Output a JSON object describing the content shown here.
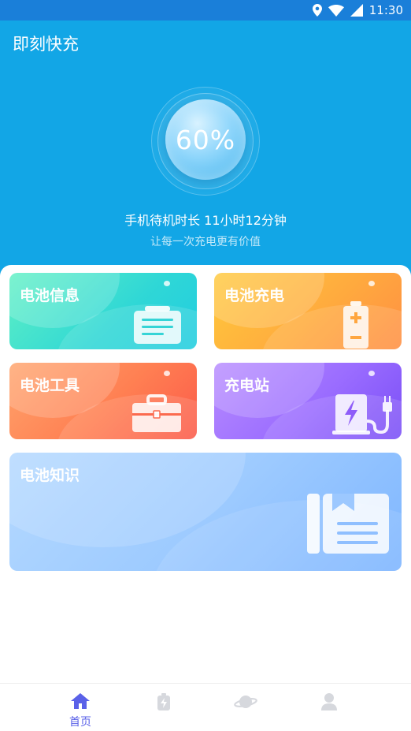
{
  "status_bar": {
    "time": "11:30"
  },
  "app": {
    "title": "即刻快充"
  },
  "battery": {
    "percent": "60%",
    "standby_text": "手机待机时长 11小时12分钟",
    "slogan": "让每一次充电更有价值"
  },
  "cards": [
    {
      "label": "电池信息",
      "icon": "battery-info-icon"
    },
    {
      "label": "电池充电",
      "icon": "battery-charge-icon"
    },
    {
      "label": "电池工具",
      "icon": "toolbox-icon"
    },
    {
      "label": "充电站",
      "icon": "charging-station-icon"
    },
    {
      "label": "电池知识",
      "icon": "book-icon"
    }
  ],
  "tabbar": {
    "tabs": [
      {
        "label": "首页",
        "icon": "home-icon",
        "active": true
      },
      {
        "label": "",
        "icon": "battery-icon",
        "active": false
      },
      {
        "label": "",
        "icon": "planet-icon",
        "active": false
      },
      {
        "label": "",
        "icon": "user-icon",
        "active": false
      }
    ]
  },
  "colors": {
    "header": "#12a6e6",
    "accent": "#5a61e8",
    "inactive": "#d6d8dd"
  }
}
